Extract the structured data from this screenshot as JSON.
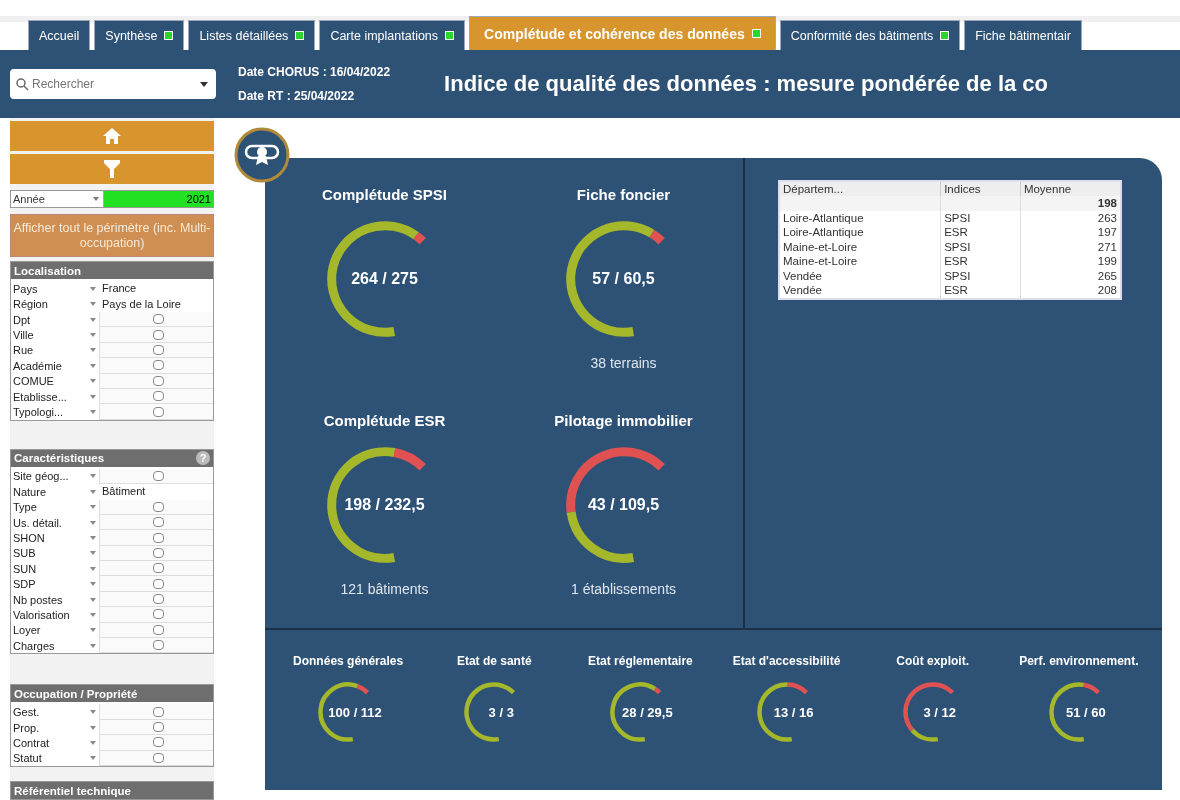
{
  "tabs": [
    {
      "label": "Accueil",
      "selected": false,
      "indicator": false
    },
    {
      "label": "Synthèse",
      "selected": false,
      "indicator": true
    },
    {
      "label": "Listes détaillées",
      "selected": false,
      "indicator": true
    },
    {
      "label": "Carte implantations",
      "selected": false,
      "indicator": true
    },
    {
      "label": "Complétude et cohérence des données",
      "selected": true,
      "indicator": true
    },
    {
      "label": "Conformité des bâtiments",
      "selected": false,
      "indicator": true
    },
    {
      "label": "Fiche bâtimentair",
      "selected": false,
      "indicator": false
    }
  ],
  "search": {
    "placeholder": "Rechercher"
  },
  "dates": [
    "Date CHORUS : 16/04/2022",
    "Date RT : 25/04/2022"
  ],
  "title": "Indice de qualité des données : mesure pondérée de la co",
  "year_filter": {
    "label": "Année",
    "value": "2021"
  },
  "perimeter_button": "Afficher tout le périmètre (inc. Multi-occupation)",
  "filter_sections": [
    {
      "title": "Localisation",
      "rows": [
        {
          "label": "Pays",
          "value": "France"
        },
        {
          "label": "Région",
          "value": "Pays de la Loire"
        },
        {
          "label": "Dpt"
        },
        {
          "label": "Ville"
        },
        {
          "label": "Rue"
        },
        {
          "label": "Académie"
        },
        {
          "label": "COMUE"
        },
        {
          "label": "Etablisse..."
        },
        {
          "label": "Typologi..."
        }
      ]
    },
    {
      "title": "Caractéristiques",
      "help": "?",
      "rows": [
        {
          "label": "Site géog..."
        },
        {
          "label": "Nature",
          "value": "Bâtiment"
        },
        {
          "label": "Type"
        },
        {
          "label": "Us. détail."
        },
        {
          "label": "SHON"
        },
        {
          "label": "SUB"
        },
        {
          "label": "SUN"
        },
        {
          "label": "SDP"
        },
        {
          "label": "Nb postes"
        },
        {
          "label": "Valorisation"
        },
        {
          "label": "Loyer"
        },
        {
          "label": "Charges"
        }
      ]
    },
    {
      "title": "Occupation / Propriété",
      "rows": [
        {
          "label": "Gest."
        },
        {
          "label": "Prop."
        },
        {
          "label": "Contrat"
        },
        {
          "label": "Statut"
        }
      ]
    },
    {
      "title": "Référentiel technique"
    }
  ],
  "main_gauges": [
    {
      "title": "Complétude SPSI",
      "value": "264 / 275"
    },
    {
      "title": "Fiche foncier",
      "value": "57 / 60,5",
      "caption": "38 terrains"
    },
    {
      "title": "Complétude ESR",
      "value": "198 / 232,5",
      "caption": "121 bâtiments"
    },
    {
      "title": "Pilotage immobilier",
      "value": "43 / 109,5",
      "caption": "1 établissements"
    }
  ],
  "table": {
    "columns": [
      "Départem...",
      "Indices",
      "Moyenne"
    ],
    "total": "198",
    "rows": [
      [
        "Loire-Atlantique",
        "SPSI",
        "263"
      ],
      [
        "Loire-Atlantique",
        "ESR",
        "197"
      ],
      [
        "Maine-et-Loire",
        "SPSI",
        "271"
      ],
      [
        "Maine-et-Loire",
        "ESR",
        "199"
      ],
      [
        "Vendée",
        "SPSI",
        "265"
      ],
      [
        "Vendée",
        "ESR",
        "208"
      ]
    ]
  },
  "sub_gauges": [
    {
      "title": "Données générales",
      "value": "100 / 112"
    },
    {
      "title": "Etat de santé",
      "value": "3 / 3"
    },
    {
      "title": "Etat réglementaire",
      "value": "28 / 29,5"
    },
    {
      "title": "Etat d'accessibilité",
      "value": "13 / 16"
    },
    {
      "title": "Coût exploit.",
      "value": "3 / 12"
    },
    {
      "title": "Perf. environnement.",
      "value": "51 / 60"
    }
  ]
}
